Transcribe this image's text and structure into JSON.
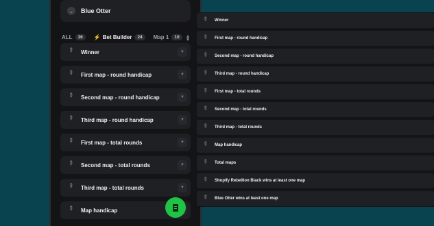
{
  "team": {
    "name": "Blue Otter"
  },
  "tabs": [
    {
      "label": "ALL",
      "count": "36"
    },
    {
      "label": "Bet Builder",
      "count": "24"
    },
    {
      "label": "Map 1",
      "count": "10"
    }
  ],
  "left_markets": [
    "Winner",
    "First map - round handicap",
    "Second map - round handicap",
    "Third map - round handicap",
    "First map - total rounds",
    "Second map - total rounds",
    "Third map - total rounds",
    "Map handicap"
  ],
  "right_markets": [
    "Winner",
    "First map - round handicap",
    "Second map - round handicap",
    "Third map - round handicap",
    "First map - total rounds",
    "Second map - total rounds",
    "Third map - total rounds",
    "Map handicap",
    "Total maps",
    "Shopify Rebellion Black wins at least one map",
    "Blue Otter wins at least one map"
  ],
  "icons": {
    "pin": "pin-icon",
    "chevron": "chevron-down-icon",
    "sort": "sort-icon",
    "betslip": "betslip-icon"
  },
  "colors": {
    "background": "#0a4350",
    "panel": "#141416",
    "card": "#1f2024",
    "accent_blue": "#2b8cff",
    "fab_green": "#1fc447"
  }
}
